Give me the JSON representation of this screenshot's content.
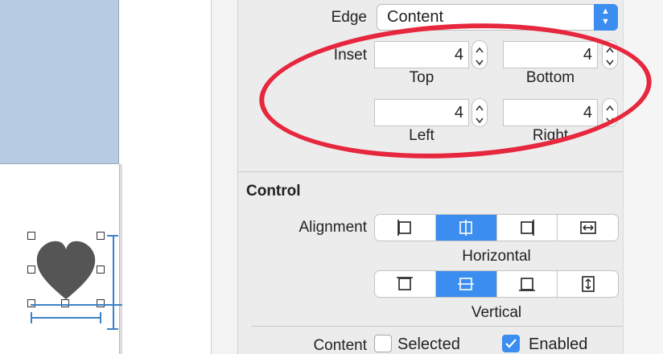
{
  "inspector": {
    "edge": {
      "label": "Edge",
      "value": "Content"
    },
    "inset": {
      "label": "Inset",
      "top": {
        "value": "4",
        "label": "Top"
      },
      "bottom": {
        "value": "4",
        "label": "Bottom"
      },
      "left": {
        "value": "4",
        "label": "Left"
      },
      "right": {
        "value": "4",
        "label": "Right"
      }
    },
    "control": {
      "title": "Control",
      "alignment_label": "Alignment",
      "horizontal": {
        "caption": "Horizontal",
        "options": [
          "left-icon",
          "center-icon",
          "right-icon",
          "fill-icon"
        ],
        "selected_index": 1
      },
      "vertical": {
        "caption": "Vertical",
        "options": [
          "top-icon",
          "center-icon",
          "bottom-icon",
          "fill-icon"
        ],
        "selected_index": 1
      },
      "content_label": "Content",
      "selected": {
        "label": "Selected",
        "checked": false
      },
      "enabled": {
        "label": "Enabled",
        "checked": true
      }
    }
  },
  "colors": {
    "accent": "#3b8ef0",
    "annotation": "#e6273d",
    "canvas_view": "#b7cce3",
    "heart": "#555555"
  }
}
